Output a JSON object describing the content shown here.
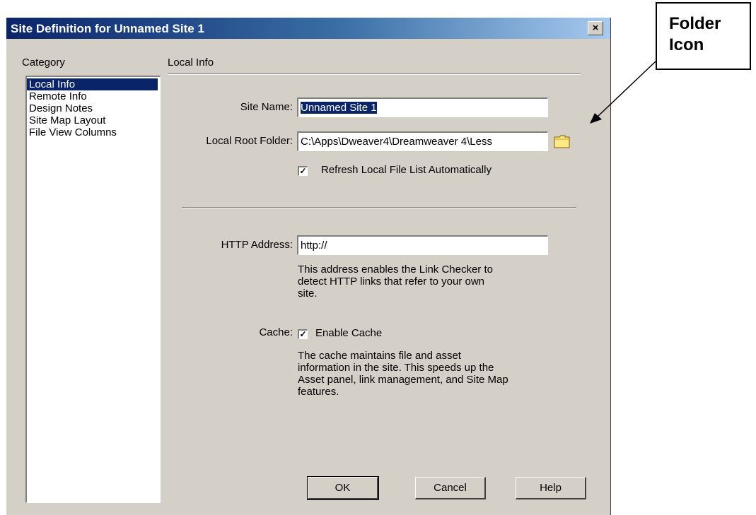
{
  "window": {
    "title": "Site Definition for Unnamed Site 1",
    "close_glyph": "×"
  },
  "category": {
    "label": "Category",
    "items": [
      "Local Info",
      "Remote Info",
      "Design Notes",
      "Site Map Layout",
      "File View Columns"
    ],
    "selected": "Local Info"
  },
  "section": {
    "title": "Local Info"
  },
  "fields": {
    "site_name_label": "Site Name:",
    "site_name_value": "Unnamed Site 1",
    "local_root_label": "Local Root Folder:",
    "local_root_value": "C:\\Apps\\Dweaver4\\Dreamweaver 4\\Less",
    "refresh_label": "Refresh Local File List Automatically",
    "refresh_checked": true,
    "http_label": "HTTP Address:",
    "http_value": "http://",
    "http_desc_lines": [
      "This address enables the Link Checker to",
      "detect HTTP links that refer to your own",
      "site."
    ],
    "cache_label": "Cache:",
    "cache_check_label": "Enable Cache",
    "cache_checked": true,
    "cache_desc_lines": [
      "The cache maintains file and asset",
      "information in the site.  This speeds up the",
      "Asset panel, link management, and Site Map",
      "features."
    ]
  },
  "buttons": {
    "ok": "OK",
    "cancel": "Cancel",
    "help": "Help"
  },
  "callout": {
    "lines": [
      "Folder",
      "Icon"
    ]
  },
  "icons": {
    "folder": "folder-icon",
    "close": "close-icon"
  },
  "colors": {
    "selection": "#0a246a",
    "dialog_bg": "#d4d0c8",
    "folder_yellow": "#ffe985"
  }
}
